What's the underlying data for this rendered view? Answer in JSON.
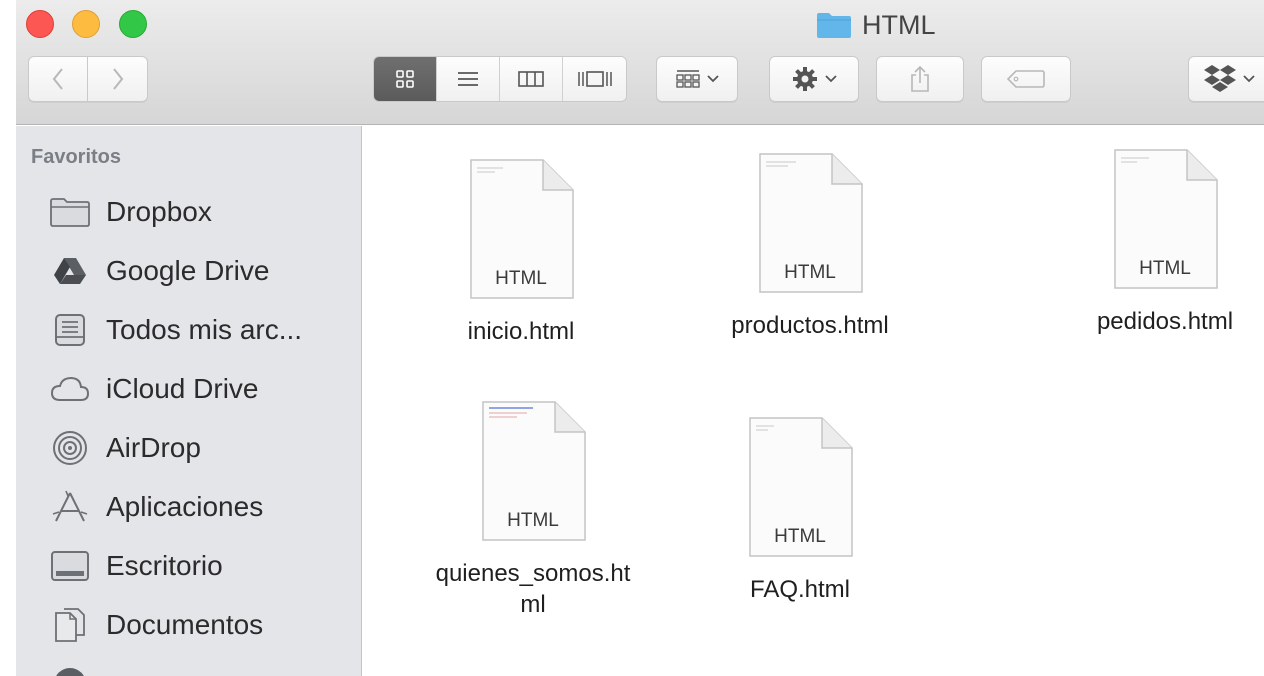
{
  "window": {
    "title": "HTML"
  },
  "toolbar": {
    "nav_back_icon": "chevron-left-icon",
    "nav_forward_icon": "chevron-right-icon",
    "views": [
      "icon-view-icon",
      "list-view-icon",
      "column-view-icon",
      "cover-flow-icon"
    ],
    "active_view": "icon-view-icon",
    "arrange_icon": "arrange-grid-icon",
    "action_icon": "gear-icon",
    "share_icon": "share-icon",
    "tags_icon": "tag-icon",
    "dropbox_icon": "dropbox-icon"
  },
  "sidebar": {
    "heading": "Favoritos",
    "items": [
      {
        "label": "Dropbox",
        "icon": "folder-icon"
      },
      {
        "label": "Google Drive",
        "icon": "google-drive-icon"
      },
      {
        "label": "Todos mis arc...",
        "icon": "all-files-icon"
      },
      {
        "label": "iCloud Drive",
        "icon": "cloud-icon"
      },
      {
        "label": "AirDrop",
        "icon": "airdrop-icon"
      },
      {
        "label": "Aplicaciones",
        "icon": "applications-icon"
      },
      {
        "label": "Escritorio",
        "icon": "desktop-icon"
      },
      {
        "label": "Documentos",
        "icon": "documents-icon"
      }
    ]
  },
  "files": [
    {
      "name": "inicio.html",
      "type": "HTML"
    },
    {
      "name": "productos.html",
      "type": "HTML"
    },
    {
      "name": "pedidos.html",
      "type": "HTML"
    },
    {
      "name": "quienes_somos.ht\nml",
      "type": "HTML"
    },
    {
      "name": "FAQ.html",
      "type": "HTML"
    }
  ],
  "colors": {
    "close": "#fc5753",
    "minimize": "#fdbc40",
    "maximize": "#33c748",
    "sidebar_bg": "#e3e5e8",
    "folder_blue": "#62b6ea"
  }
}
